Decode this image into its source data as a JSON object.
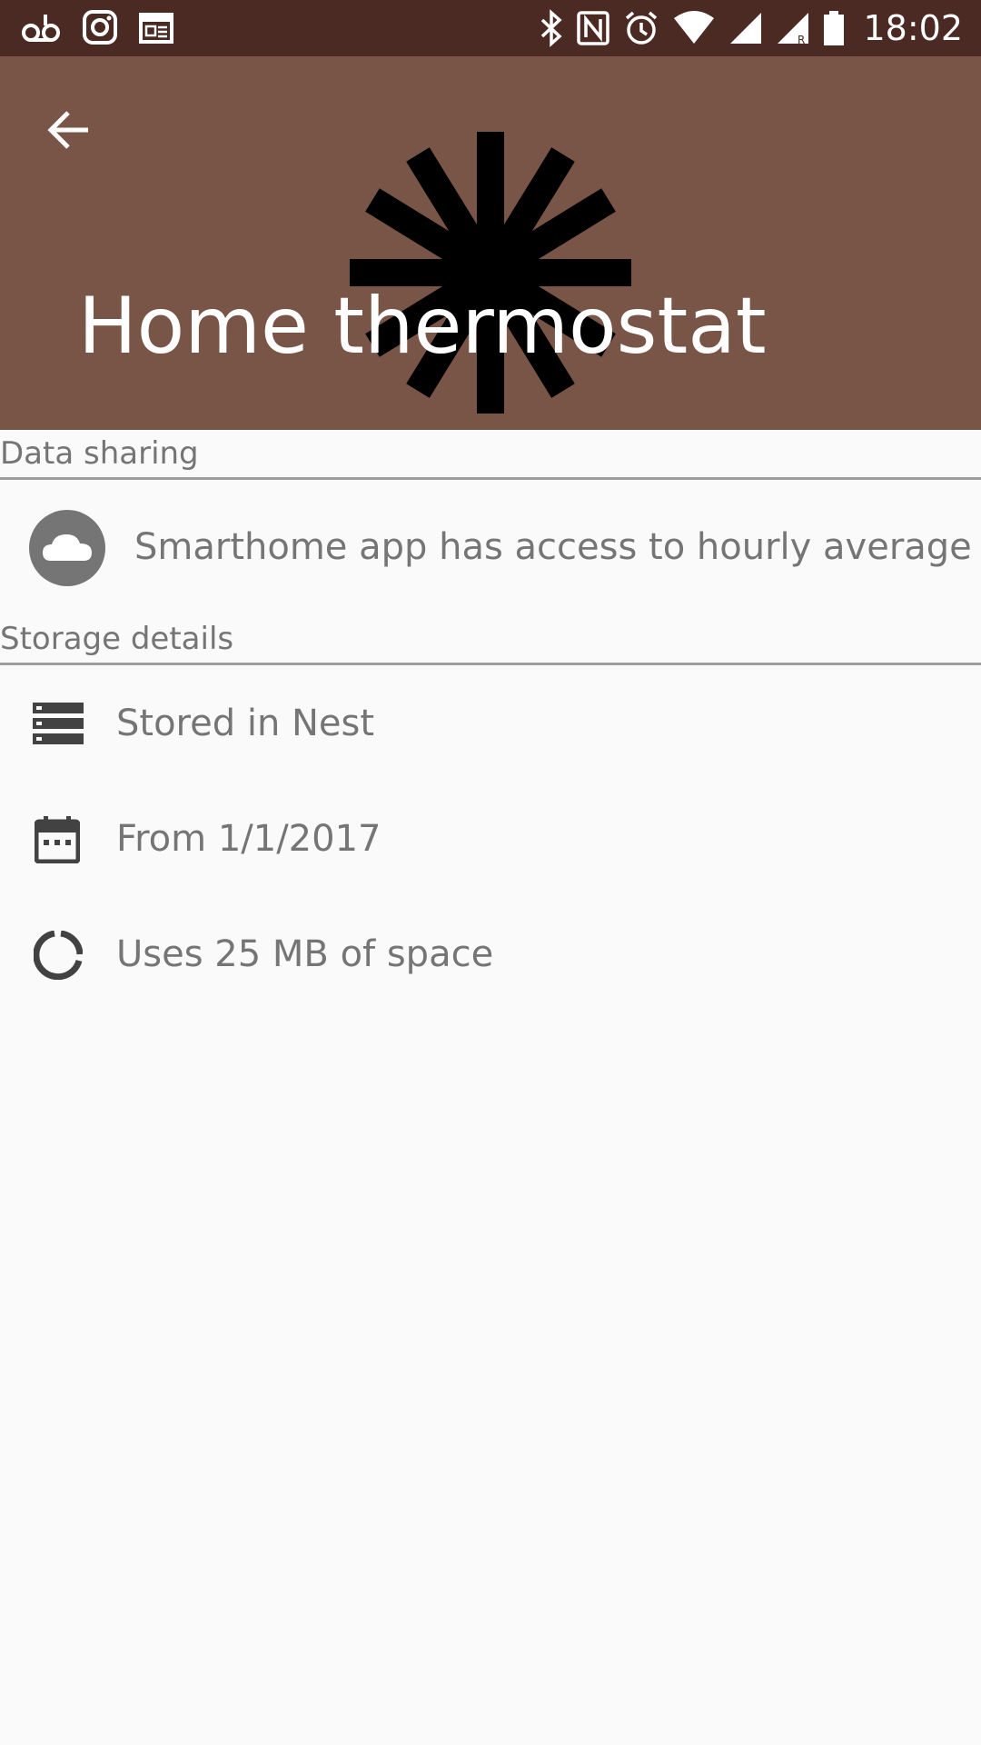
{
  "status_bar": {
    "time": "18:02",
    "left_icons": [
      "voicemail-icon",
      "instagram-icon",
      "calendar-news-icon"
    ],
    "right_icons": [
      "bluetooth-icon",
      "nfc-icon",
      "alarm-icon",
      "wifi-icon",
      "signal-icon",
      "signal-roaming-icon",
      "battery-icon"
    ]
  },
  "header": {
    "title": "Home thermostat",
    "background_color": "#795548",
    "icon": "snowflake-icon"
  },
  "data_sharing": {
    "section_title": "Data sharing",
    "items": [
      {
        "icon": "cloud-icon",
        "text": "Smarthome app has access to hourly average"
      }
    ]
  },
  "storage_details": {
    "section_title": "Storage details",
    "items": [
      {
        "icon": "storage-icon",
        "text": "Stored in Nest"
      },
      {
        "icon": "calendar-icon",
        "text": "From 1/1/2017"
      },
      {
        "icon": "data-usage-icon",
        "text": "Uses 25 MB of space"
      }
    ]
  }
}
